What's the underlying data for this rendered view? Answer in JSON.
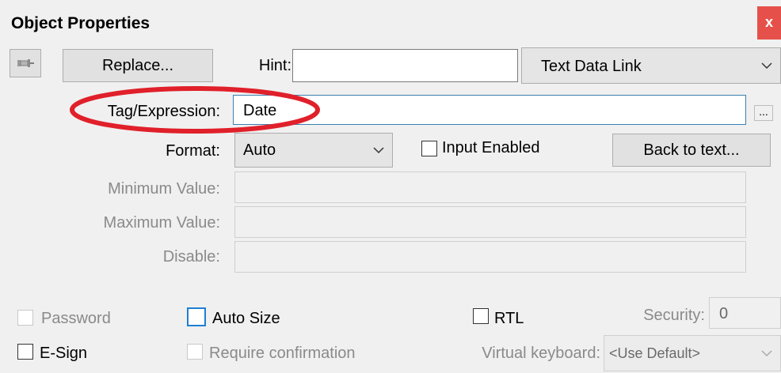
{
  "window": {
    "title": "Object Properties",
    "close": "x"
  },
  "toolbar": {
    "pin_icon": "pin-icon",
    "replace_label": "Replace...",
    "hint_label": "Hint:",
    "hint_value": "",
    "type_value": "Text Data Link"
  },
  "form": {
    "tag_label": "Tag/Expression:",
    "tag_value": "Date",
    "browse_label": "...",
    "format_label": "Format:",
    "format_value": "Auto",
    "input_enabled_label": "Input Enabled",
    "back_to_text_label": "Back to text...",
    "min_label": "Minimum Value:",
    "max_label": "Maximum Value:",
    "disable_label": "Disable:"
  },
  "options": {
    "password_label": "Password",
    "auto_size_label": "Auto Size",
    "rtl_label": "RTL",
    "security_label": "Security:",
    "security_value": "0",
    "esign_label": "E-Sign",
    "require_confirmation_label": "Require confirmation",
    "virtual_keyboard_label": "Virtual keyboard:",
    "virtual_keyboard_value": "<Use Default>"
  },
  "colors": {
    "highlight": "#e0202a",
    "close_bg": "#e5514a",
    "focus": "#1f7fd2"
  }
}
